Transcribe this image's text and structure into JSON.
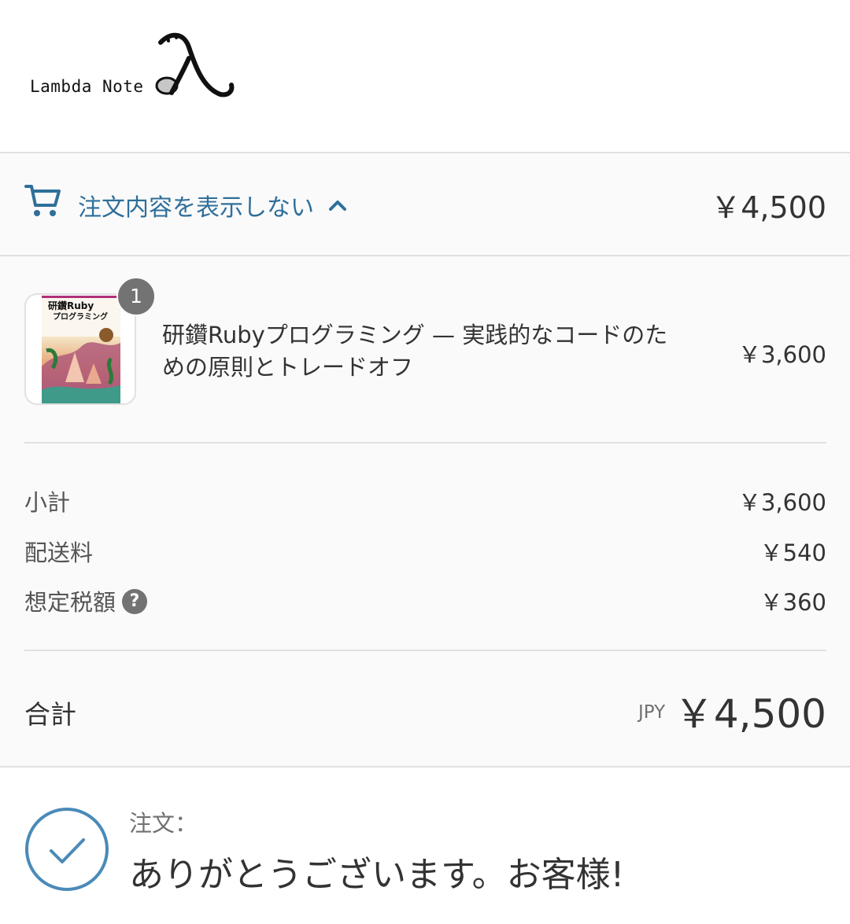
{
  "brand": {
    "name": "Lambda Note"
  },
  "summary_toggle": {
    "label": "注文内容を表示しない",
    "total": "￥4,500",
    "icons": [
      "cart-icon",
      "chevron-up-icon"
    ]
  },
  "line_items": [
    {
      "title": "研鑽Rubyプログラミング — 実践的なコードのための原則とトレードオフ",
      "price": "￥3,600",
      "quantity": "1",
      "cover_text": [
        "研鑽Ruby",
        "プログラミング"
      ]
    }
  ],
  "totals": {
    "subtotal_label": "小計",
    "subtotal_value": "￥3,600",
    "shipping_label": "配送料",
    "shipping_value": "￥540",
    "tax_label": "想定税額",
    "tax_help": "?",
    "tax_value": "￥360",
    "total_label": "合計",
    "total_currency": "JPY",
    "total_value": "￥4,500"
  },
  "thank_you": {
    "order_label": "注文：",
    "heading": "ありがとうございます。お客様!",
    "icon": "checkmark-circle-icon"
  },
  "colors": {
    "accent": "#2f6f9a",
    "summary_background": "#fafafa",
    "border": "#e1e1e1",
    "badge": "#737373",
    "text": "#333333",
    "muted_text": "#717171"
  }
}
